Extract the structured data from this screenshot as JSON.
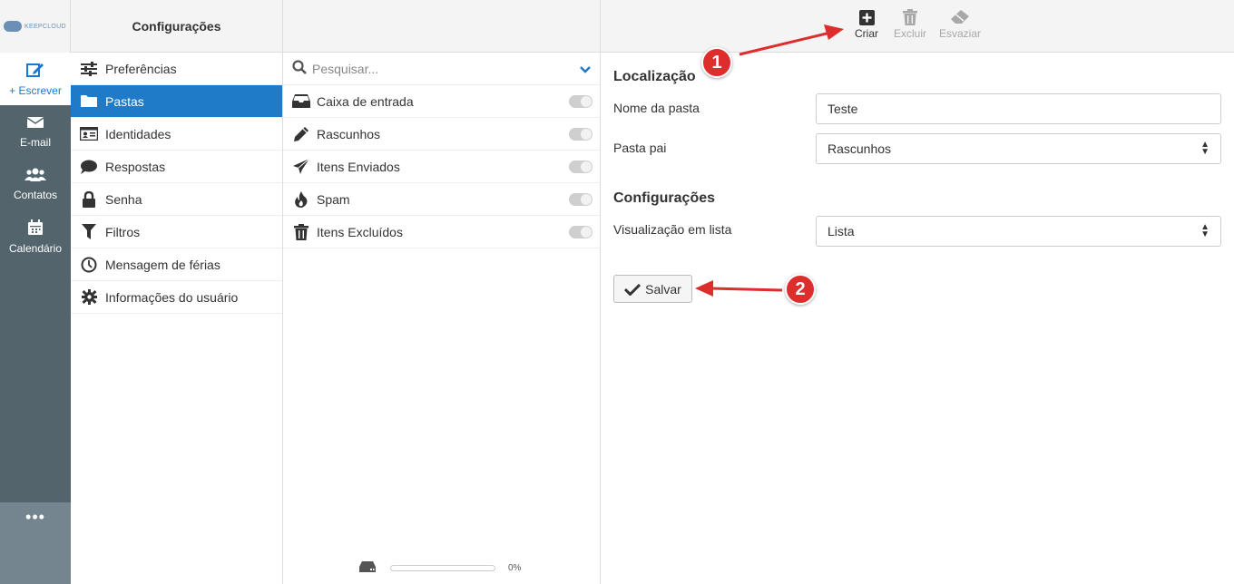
{
  "brand": {
    "logo_text": "KEEPCLOUD"
  },
  "rail": {
    "items": [
      {
        "label": "+ Escrever",
        "icon": "compose-icon"
      },
      {
        "label": "E-mail",
        "icon": "envelope-icon"
      },
      {
        "label": "Contatos",
        "icon": "users-icon"
      },
      {
        "label": "Calendário",
        "icon": "calendar-icon"
      }
    ],
    "more": "•••"
  },
  "settings": {
    "title": "Configurações",
    "items": [
      {
        "label": "Preferências",
        "icon": "sliders-icon"
      },
      {
        "label": "Pastas",
        "icon": "folder-icon",
        "active": true
      },
      {
        "label": "Identidades",
        "icon": "id-card-icon"
      },
      {
        "label": "Respostas",
        "icon": "comment-icon"
      },
      {
        "label": "Senha",
        "icon": "lock-icon"
      },
      {
        "label": "Filtros",
        "icon": "filter-icon"
      },
      {
        "label": "Mensagem de férias",
        "icon": "clock-icon"
      },
      {
        "label": "Informações do usuário",
        "icon": "gear-icon"
      }
    ]
  },
  "folders": {
    "search_placeholder": "Pesquisar...",
    "items": [
      {
        "label": "Caixa de entrada",
        "icon": "inbox-icon"
      },
      {
        "label": "Rascunhos",
        "icon": "pencil-icon"
      },
      {
        "label": "Itens Enviados",
        "icon": "paper-plane-icon"
      },
      {
        "label": "Spam",
        "icon": "fire-icon"
      },
      {
        "label": "Itens Excluídos",
        "icon": "trash-icon"
      }
    ],
    "quota_percent": "0%",
    "quota_fraction": 0
  },
  "toolbar": {
    "create": "Criar",
    "delete": "Excluir",
    "empty": "Esvaziar"
  },
  "form": {
    "section_location": "Localização",
    "folder_name_label": "Nome da pasta",
    "folder_name_value": "Teste",
    "parent_label": "Pasta pai",
    "parent_value": "Rascunhos",
    "section_settings": "Configurações",
    "list_view_label": "Visualização em lista",
    "list_view_value": "Lista",
    "save": "Salvar"
  },
  "annotations": {
    "step1": "1",
    "step2": "2",
    "color": "#dd2d2d"
  },
  "colors": {
    "accent": "#1f7ac8",
    "rail": "#54646d",
    "compose": "#1978d4"
  }
}
